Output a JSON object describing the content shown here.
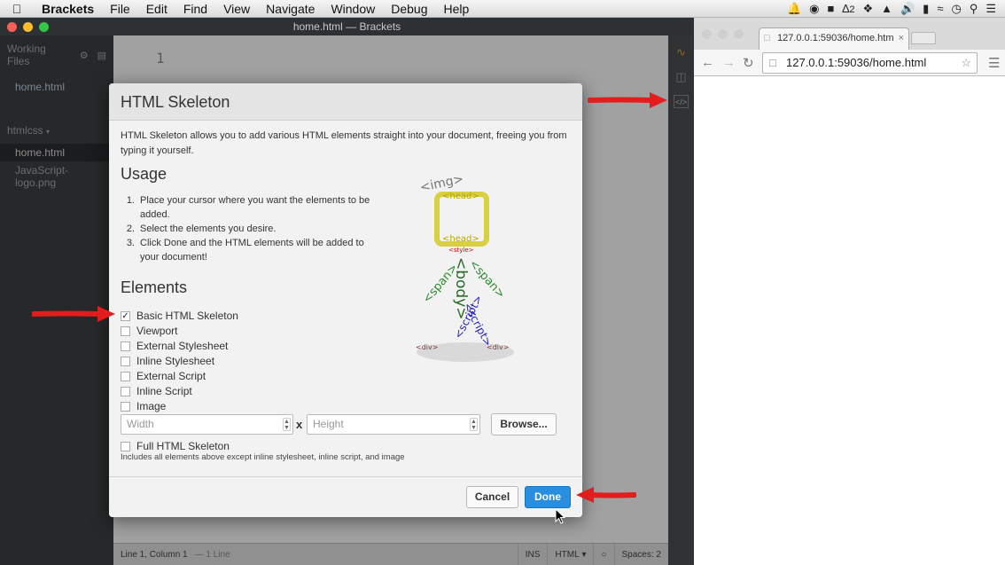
{
  "menubar": {
    "app": "Brackets",
    "items": [
      "File",
      "Edit",
      "Find",
      "View",
      "Navigate",
      "Window",
      "Debug",
      "Help"
    ],
    "status_text": "2"
  },
  "brackets": {
    "window_title": "home.html — Brackets",
    "sidebar": {
      "working_files_label": "Working Files",
      "working_files": [
        "home.html"
      ],
      "project_label": "htmlcss",
      "project_files": [
        "home.html",
        "JavaScript-logo.png"
      ]
    },
    "editor": {
      "line_number": "1"
    },
    "statusbar": {
      "position": "Line 1, Column 1",
      "lines": "— 1 Line",
      "mode": "INS",
      "language": "HTML",
      "spaces": "Spaces: 2"
    }
  },
  "dialog": {
    "title": "HTML Skeleton",
    "description": "HTML Skeleton allows you to add various HTML elements straight into your document, freeing you from typing it yourself.",
    "usage_heading": "Usage",
    "steps": [
      {
        "num": "1.",
        "text": "Place your cursor where you want the elements to be added."
      },
      {
        "num": "2.",
        "text": "Select the elements you desire."
      },
      {
        "num": "3.",
        "text": "Click Done and the HTML elements will be added to your document!"
      }
    ],
    "elements_heading": "Elements",
    "options": [
      {
        "label": "Basic HTML Skeleton",
        "checked": true
      },
      {
        "label": "Viewport",
        "checked": false
      },
      {
        "label": "External Stylesheet",
        "checked": false
      },
      {
        "label": "Inline Stylesheet",
        "checked": false
      },
      {
        "label": "External Script",
        "checked": false
      },
      {
        "label": "Inline Script",
        "checked": false
      },
      {
        "label": "Image",
        "checked": false
      }
    ],
    "width_placeholder": "Width",
    "times": "x",
    "height_placeholder": "Height",
    "browse_label": "Browse...",
    "full_label": "Full HTML Skeleton",
    "full_note": "Includes all elements above except inline stylesheet, inline script, and image",
    "cancel_label": "Cancel",
    "done_label": "Done",
    "figure": {
      "img": "<img>",
      "head": "<head>",
      "style": "<style>",
      "span": "<span>",
      "body": "<body>",
      "script": "<script>",
      "div": "<div>"
    }
  },
  "chrome": {
    "tab_title": "127.0.0.1:59036/home.htm",
    "url": "127.0.0.1:59036/home.html"
  },
  "colors": {
    "accent": "#288edf",
    "arrow": "#e11d1d"
  }
}
